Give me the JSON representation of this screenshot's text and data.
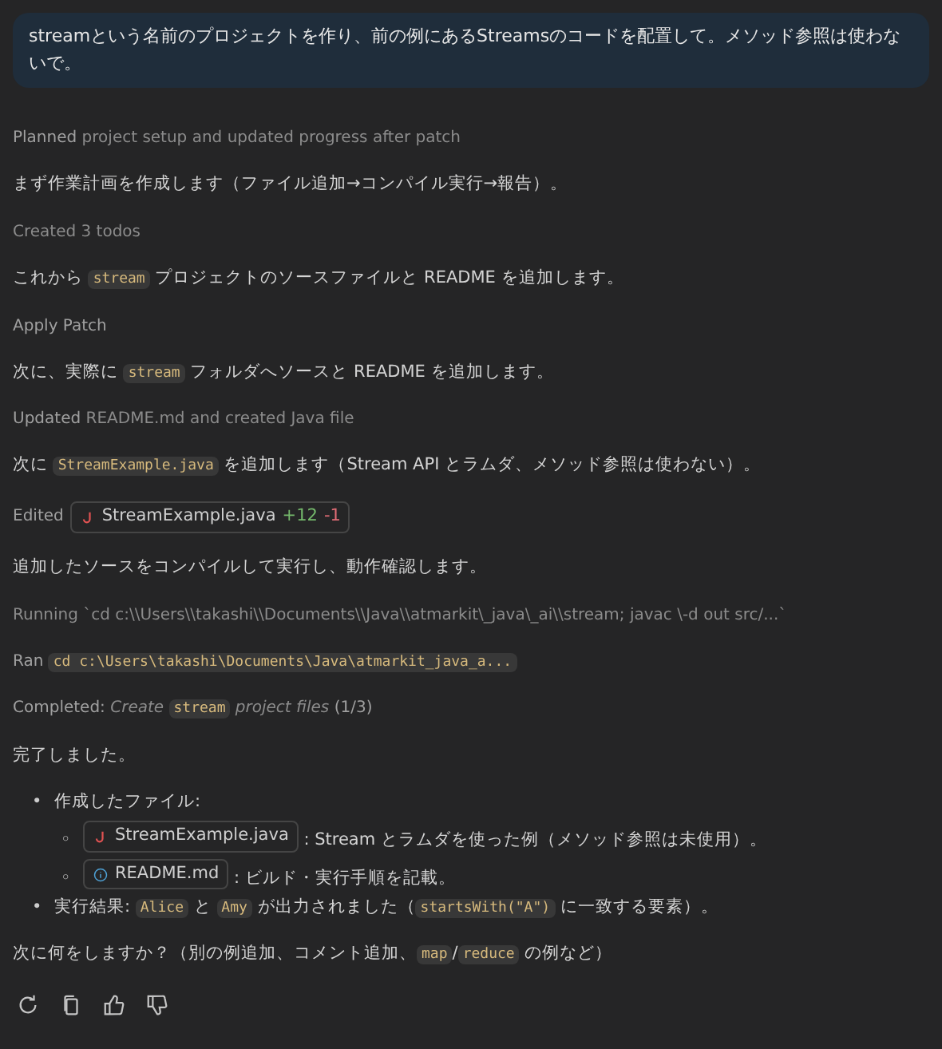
{
  "user_message": "streamという名前のプロジェクトを作り、前の例にあるStreamsのコードを配置して。メソッド参照は使わないで。",
  "blocks": [
    {
      "kind": "status",
      "parts": [
        {
          "kind": "lead",
          "text": "Planned"
        },
        {
          "kind": "text",
          "text": " project setup and updated progress after patch"
        }
      ]
    },
    {
      "kind": "text",
      "parts": [
        {
          "kind": "text",
          "text": "まず作業計画を作成します（ファイル追加→コンパイル実行→報告）。"
        }
      ]
    },
    {
      "kind": "status",
      "parts": [
        {
          "kind": "text",
          "text": "Created 3 todos"
        }
      ]
    },
    {
      "kind": "text",
      "parts": [
        {
          "kind": "text",
          "text": "これから "
        },
        {
          "kind": "code",
          "text": "stream"
        },
        {
          "kind": "text",
          "text": " プロジェクトのソースファイルと README を追加します。"
        }
      ]
    },
    {
      "kind": "status",
      "parts": [
        {
          "kind": "lead",
          "text": "Apply Patch"
        }
      ]
    },
    {
      "kind": "text",
      "parts": [
        {
          "kind": "text",
          "text": "次に、実際に "
        },
        {
          "kind": "code",
          "text": "stream"
        },
        {
          "kind": "text",
          "text": " フォルダへソースと README を追加します。"
        }
      ]
    },
    {
      "kind": "status",
      "parts": [
        {
          "kind": "lead",
          "text": "Updated"
        },
        {
          "kind": "text",
          "text": " README.md and created Java file"
        }
      ]
    },
    {
      "kind": "text",
      "parts": [
        {
          "kind": "text",
          "text": "次に "
        },
        {
          "kind": "code",
          "text": "StreamExample.java"
        },
        {
          "kind": "text",
          "text": " を追加します（Stream API とラムダ、メソッド参照は使わない）。"
        }
      ]
    },
    {
      "kind": "status",
      "parts": [
        {
          "kind": "lead",
          "text": "Edited"
        },
        {
          "kind": "java_file",
          "name": "StreamExample.java",
          "added": "+12",
          "removed": "-1"
        }
      ]
    },
    {
      "kind": "text",
      "parts": [
        {
          "kind": "text",
          "text": "追加したソースをコンパイルして実行し、動作確認します。"
        }
      ]
    },
    {
      "kind": "status",
      "parts": [
        {
          "kind": "text",
          "text": "Running `cd c:\\\\Users\\\\takashi\\\\Documents\\\\Java\\\\atmarkit\\_java\\_ai\\\\stream; javac \\-d out src/...`"
        }
      ]
    },
    {
      "kind": "status",
      "parts": [
        {
          "kind": "lead",
          "text": "Ran "
        },
        {
          "kind": "code",
          "text": "cd c:\\Users\\takashi\\Documents\\Java\\atmarkit_java_a..."
        }
      ]
    },
    {
      "kind": "status",
      "parts": [
        {
          "kind": "lead",
          "text": "Completed: "
        },
        {
          "kind": "italic",
          "text": "Create "
        },
        {
          "kind": "code",
          "text": "stream"
        },
        {
          "kind": "italic",
          "text": " project files"
        },
        {
          "kind": "lead",
          "text": " (1/3)"
        }
      ]
    },
    {
      "kind": "text",
      "parts": [
        {
          "kind": "text",
          "text": "完了しました。"
        }
      ]
    },
    {
      "kind": "list",
      "items": [
        {
          "marker": "•",
          "parts": [
            {
              "kind": "text",
              "text": "作成したファイル:"
            }
          ],
          "children": [
            {
              "marker": "◦",
              "parts": [
                {
                  "kind": "java_file",
                  "name": "StreamExample.java"
                },
                {
                  "kind": "text",
                  "text": " : Stream とラムダを使った例（メソッド参照は未使用）。"
                }
              ]
            },
            {
              "marker": "◦",
              "parts": [
                {
                  "kind": "readme_file",
                  "name": "README.md"
                },
                {
                  "kind": "text",
                  "text": " : ビルド・実行手順を記載。"
                }
              ]
            }
          ]
        },
        {
          "marker": "•",
          "parts": [
            {
              "kind": "text",
              "text": "実行結果: "
            },
            {
              "kind": "code",
              "text": "Alice"
            },
            {
              "kind": "text",
              "text": " と "
            },
            {
              "kind": "code",
              "text": "Amy"
            },
            {
              "kind": "text",
              "text": " が出力されました（"
            },
            {
              "kind": "code",
              "text": "startsWith(\"A\")"
            },
            {
              "kind": "text",
              "text": " に一致する要素）。"
            }
          ]
        }
      ]
    },
    {
      "kind": "text",
      "parts": [
        {
          "kind": "text",
          "text": "次に何をしますか？（別の例追加、コメント追加、"
        },
        {
          "kind": "code",
          "text": "map"
        },
        {
          "kind": "text",
          "text": "/"
        },
        {
          "kind": "code",
          "text": "reduce"
        },
        {
          "kind": "text",
          "text": " の例など）"
        }
      ]
    }
  ],
  "actions": [
    {
      "kind": "retry"
    },
    {
      "kind": "copy"
    },
    {
      "kind": "like"
    },
    {
      "kind": "dislike"
    }
  ]
}
